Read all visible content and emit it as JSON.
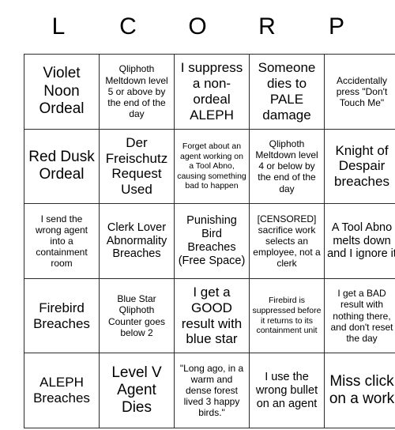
{
  "card": {
    "title_letters": [
      "L",
      "C",
      "O",
      "R",
      "P"
    ],
    "columns": [
      "L",
      "C",
      "O",
      "R",
      "P"
    ],
    "free_space_index": {
      "row": 2,
      "col": 2
    },
    "rows": [
      [
        {
          "text": "Violet Noon Ordeal",
          "size": "fs-xl"
        },
        {
          "text": "Qliphoth Meltdown level 5 or above by the end of the day",
          "size": "fs-sm"
        },
        {
          "text": "I suppress a non-ordeal ALEPH",
          "size": "fs-lg"
        },
        {
          "text": "Someone dies to PALE damage",
          "size": "fs-lg"
        },
        {
          "text": "Accidentally press \"Don't Touch Me\"",
          "size": "fs-sm"
        }
      ],
      [
        {
          "text": "Red Dusk Ordeal",
          "size": "fs-xl"
        },
        {
          "text": "Der Freischutz Request Used",
          "size": "fs-lg"
        },
        {
          "text": "Forget about an agent working on a Tool Abno, causing something bad to happen",
          "size": "fs-xs"
        },
        {
          "text": "Qliphoth Meltdown level 4 or below by the end of the day",
          "size": "fs-sm"
        },
        {
          "text": "Knight of Despair breaches",
          "size": "fs-lg"
        }
      ],
      [
        {
          "text": "I send the wrong agent into a containment room",
          "size": "fs-sm"
        },
        {
          "text": "Clerk Lover Abnormality Breaches",
          "size": "fs-md"
        },
        {
          "text": "Punishing Bird Breaches (Free Space)",
          "size": "fs-md"
        },
        {
          "text": "[CENSORED] sacrifice work selects an employee, not a clerk",
          "size": "fs-sm"
        },
        {
          "text": "A Tool Abno melts down and I ignore it",
          "size": "fs-md"
        }
      ],
      [
        {
          "text": "Firebird Breaches",
          "size": "fs-lg"
        },
        {
          "text": "Blue Star Qliphoth Counter goes below 2",
          "size": "fs-sm"
        },
        {
          "text": "I get a GOOD result with blue star",
          "size": "fs-lg"
        },
        {
          "text": "Firebird is suppressed before it returns to its containment unit",
          "size": "fs-xs"
        },
        {
          "text": "I get a BAD result with nothing there, and don't reset the day",
          "size": "fs-sm"
        }
      ],
      [
        {
          "text": "ALEPH Breaches",
          "size": "fs-lg"
        },
        {
          "text": "Level V Agent Dies",
          "size": "fs-xl"
        },
        {
          "text": "\"Long ago, in a warm and dense forest lived 3 happy birds.\"",
          "size": "fs-sm"
        },
        {
          "text": "I use the wrong bullet on an agent",
          "size": "fs-md"
        },
        {
          "text": "Miss click on a work",
          "size": "fs-xl"
        }
      ]
    ],
    "colors": {
      "background": "#ffffff",
      "text": "#000000",
      "grid_line": "#2b2b2b"
    }
  }
}
